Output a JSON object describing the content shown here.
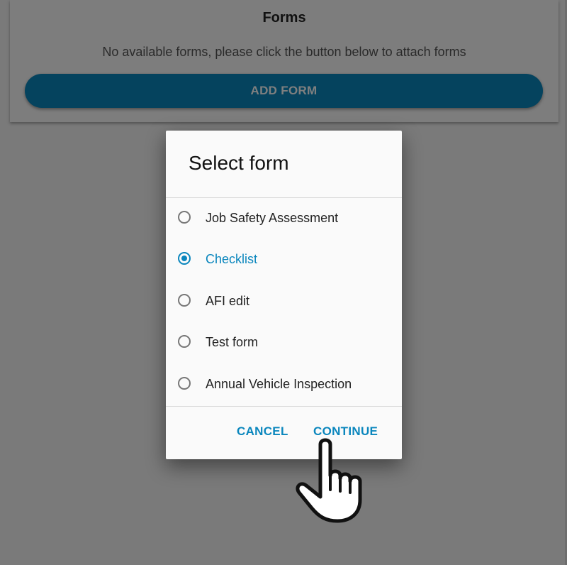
{
  "forms_section": {
    "title": "Forms",
    "description": "No available forms, please click the button below to attach forms",
    "add_button_label": "ADD FORM"
  },
  "dialog": {
    "title": "Select form",
    "options": [
      {
        "label": "Job Safety Assessment",
        "selected": false
      },
      {
        "label": "Checklist",
        "selected": true
      },
      {
        "label": "AFI edit",
        "selected": false
      },
      {
        "label": "Test form",
        "selected": false
      },
      {
        "label": "Annual Vehicle Inspection",
        "selected": false
      }
    ],
    "cancel_label": "CANCEL",
    "continue_label": "CONTINUE"
  },
  "colors": {
    "accent": "#0a86bd",
    "scrim": "rgba(0,0,0,0.5)"
  },
  "cursor": {
    "icon": "pointing-hand-icon"
  }
}
